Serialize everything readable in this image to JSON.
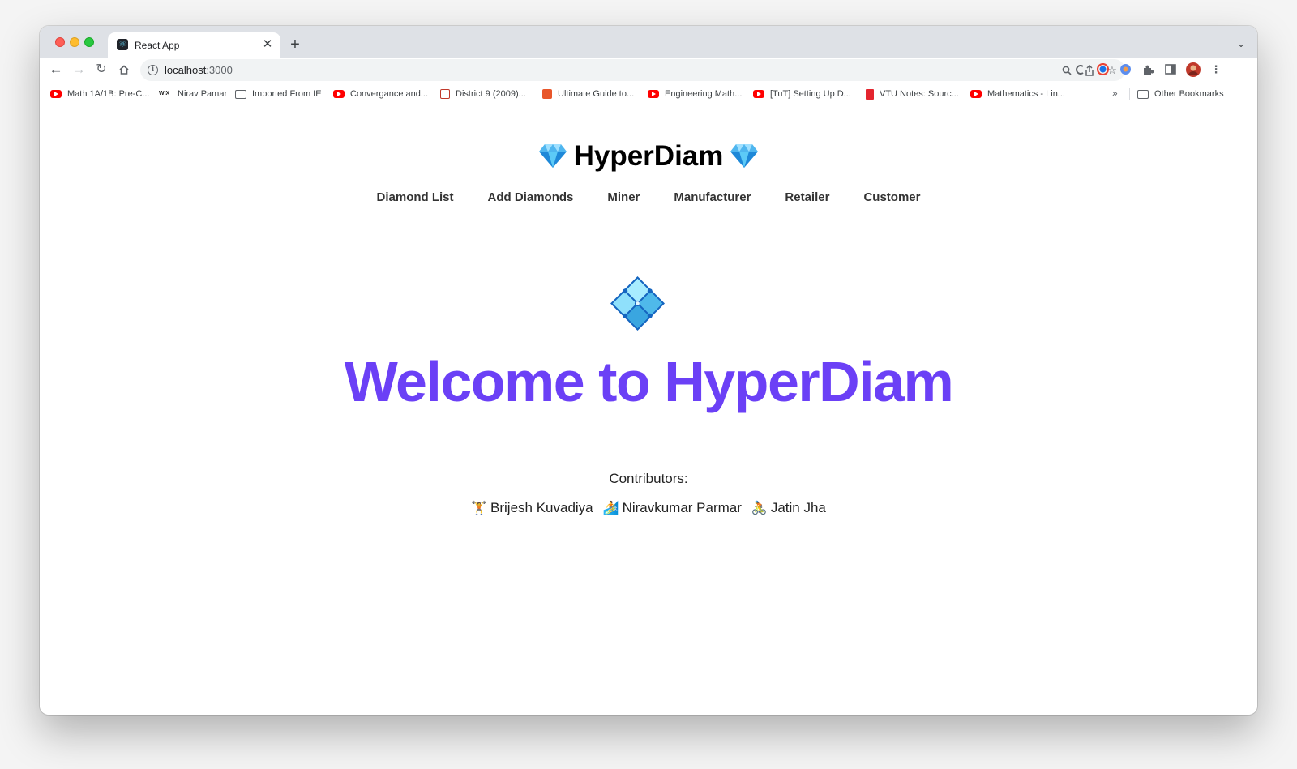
{
  "browser": {
    "tab_title": "React App",
    "tab_close": "✕",
    "new_tab": "+",
    "url_host": "localhost",
    "url_port": ":3000"
  },
  "bookmarks": [
    {
      "label": "Math 1A/1B: Pre-C...",
      "icon": "youtube-icon"
    },
    {
      "label": "Nirav Pamar",
      "icon": "wix-icon",
      "icon_text": "WIX"
    },
    {
      "label": "Imported From IE",
      "icon": "folder-icon"
    },
    {
      "label": "Convergance and...",
      "icon": "youtube-icon"
    },
    {
      "label": "District 9 (2009)...",
      "icon": "site-icon"
    },
    {
      "label": "Ultimate Guide to...",
      "icon": "site-icon"
    },
    {
      "label": "Engineering Math...",
      "icon": "youtube-icon"
    },
    {
      "label": "[TuT] Setting Up D...",
      "icon": "youtube-icon"
    },
    {
      "label": "VTU Notes: Sourc...",
      "icon": "site-icon"
    },
    {
      "label": "Mathematics - Lin...",
      "icon": "youtube-icon"
    }
  ],
  "bookmarks_more": "»",
  "other_bookmarks": "Other Bookmarks",
  "app": {
    "brand": "HyperDiam",
    "nav": [
      "Diamond List",
      "Add Diamonds",
      "Miner",
      "Manufacturer",
      "Retailer",
      "Customer"
    ],
    "hero_title": "Welcome to HyperDiam",
    "contributors_label": "Contributors:",
    "contributors": [
      {
        "emoji": "🏋",
        "name": "Brijesh Kuvadiya"
      },
      {
        "emoji": "🏄",
        "name": "Niravkumar Parmar"
      },
      {
        "emoji": "🚴",
        "name": "Jatin Jha"
      }
    ]
  },
  "colors": {
    "accent": "#6b40f6",
    "tabstrip": "#dee1e6",
    "gem": "#4fc3f7"
  }
}
